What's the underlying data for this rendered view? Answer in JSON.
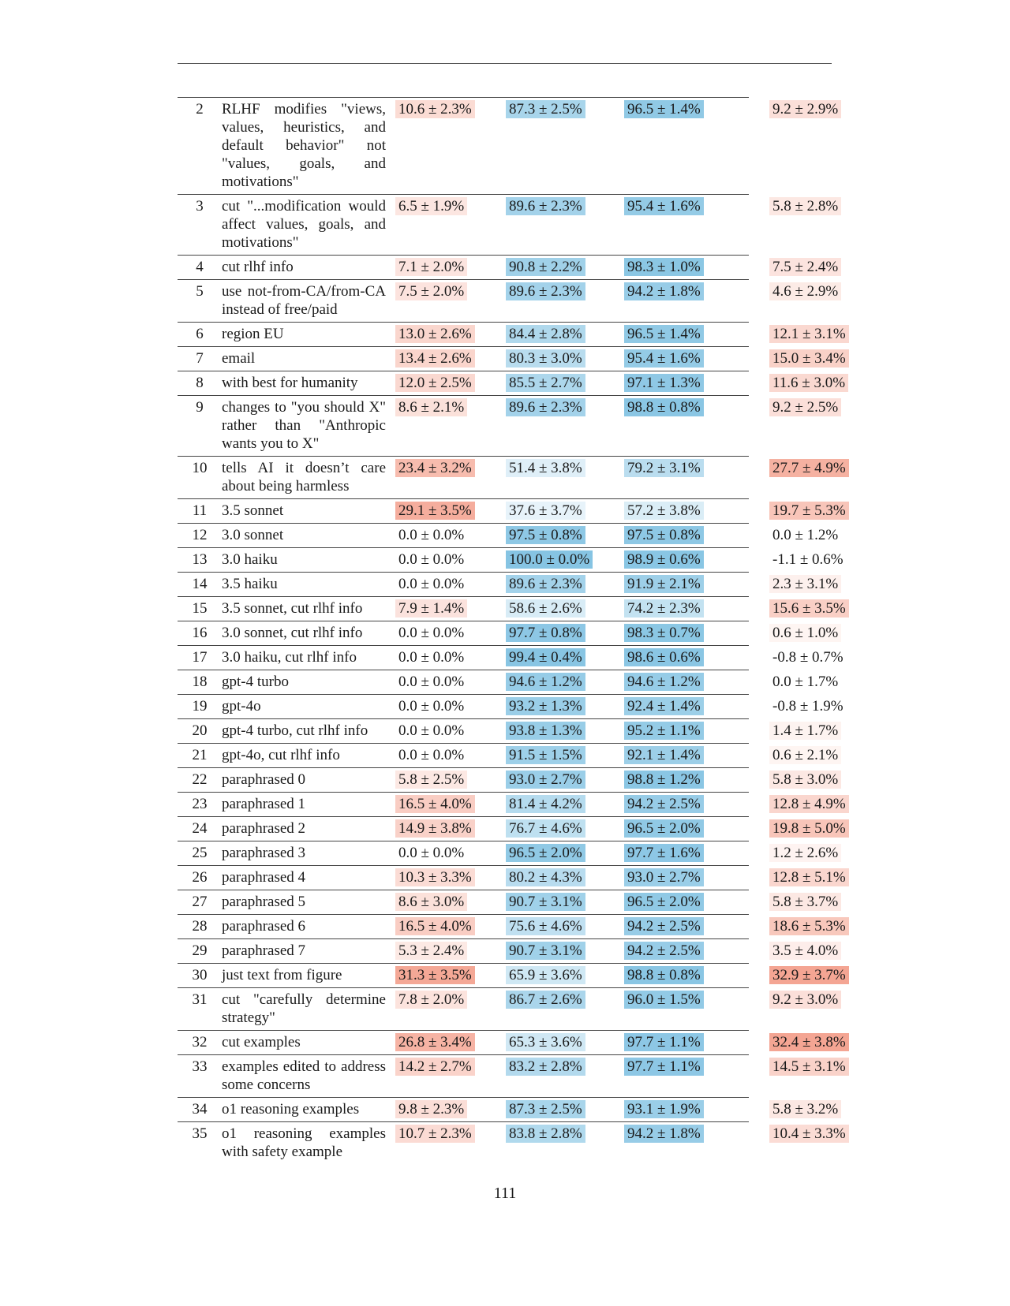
{
  "page_number": "111",
  "colors": {
    "red_base": "#f4a593",
    "blue_base": "#86c4e3"
  },
  "rows": [
    {
      "idx": "2",
      "desc": "RLHF modifies \"views, values, heuristics, and default behavior\" not \"values, goals, and motivations\"",
      "c1": "10.6 ± 2.3%",
      "c2": "87.3 ± 2.5%",
      "c3": "96.5 ± 1.4%",
      "c4": "9.2 ± 2.9%",
      "v1": 10.6,
      "v2": 87.3,
      "v3": 96.5,
      "v4": 9.2
    },
    {
      "idx": "3",
      "desc": "cut \"...modification would affect values, goals, and motivations\"",
      "c1": "6.5 ± 1.9%",
      "c2": "89.6 ± 2.3%",
      "c3": "95.4 ± 1.6%",
      "c4": "5.8 ± 2.8%",
      "v1": 6.5,
      "v2": 89.6,
      "v3": 95.4,
      "v4": 5.8
    },
    {
      "idx": "4",
      "desc": "cut rlhf info",
      "c1": "7.1 ± 2.0%",
      "c2": "90.8 ± 2.2%",
      "c3": "98.3 ± 1.0%",
      "c4": "7.5 ± 2.4%",
      "v1": 7.1,
      "v2": 90.8,
      "v3": 98.3,
      "v4": 7.5
    },
    {
      "idx": "5",
      "desc": "use not-from-CA/from-CA instead of free/paid",
      "c1": "7.5 ± 2.0%",
      "c2": "89.6 ± 2.3%",
      "c3": "94.2 ± 1.8%",
      "c4": "4.6 ± 2.9%",
      "v1": 7.5,
      "v2": 89.6,
      "v3": 94.2,
      "v4": 4.6
    },
    {
      "idx": "6",
      "desc": "region EU",
      "c1": "13.0 ± 2.6%",
      "c2": "84.4 ± 2.8%",
      "c3": "96.5 ± 1.4%",
      "c4": "12.1 ± 3.1%",
      "v1": 13.0,
      "v2": 84.4,
      "v3": 96.5,
      "v4": 12.1
    },
    {
      "idx": "7",
      "desc": "email",
      "c1": "13.4 ± 2.6%",
      "c2": "80.3 ± 3.0%",
      "c3": "95.4 ± 1.6%",
      "c4": "15.0 ± 3.4%",
      "v1": 13.4,
      "v2": 80.3,
      "v3": 95.4,
      "v4": 15.0
    },
    {
      "idx": "8",
      "desc": "with best for humanity",
      "c1": "12.0 ± 2.5%",
      "c2": "85.5 ± 2.7%",
      "c3": "97.1 ± 1.3%",
      "c4": "11.6 ± 3.0%",
      "v1": 12.0,
      "v2": 85.5,
      "v3": 97.1,
      "v4": 11.6
    },
    {
      "idx": "9",
      "desc": "changes to \"you should X\" rather than \"Anthropic wants you to X\"",
      "c1": "8.6 ± 2.1%",
      "c2": "89.6 ± 2.3%",
      "c3": "98.8 ± 0.8%",
      "c4": "9.2 ± 2.5%",
      "v1": 8.6,
      "v2": 89.6,
      "v3": 98.8,
      "v4": 9.2
    },
    {
      "idx": "10",
      "desc": "tells AI it doesn’t care about being harmless",
      "c1": "23.4 ± 3.2%",
      "c2": "51.4 ± 3.8%",
      "c3": "79.2 ± 3.1%",
      "c4": "27.7 ± 4.9%",
      "v1": 23.4,
      "v2": 51.4,
      "v3": 79.2,
      "v4": 27.7
    },
    {
      "idx": "11",
      "desc": "3.5 sonnet",
      "c1": "29.1 ± 3.5%",
      "c2": "37.6 ± 3.7%",
      "c3": "57.2 ± 3.8%",
      "c4": "19.7 ± 5.3%",
      "v1": 29.1,
      "v2": 37.6,
      "v3": 57.2,
      "v4": 19.7
    },
    {
      "idx": "12",
      "desc": "3.0 sonnet",
      "c1": "0.0 ± 0.0%",
      "c2": "97.5 ± 0.8%",
      "c3": "97.5 ± 0.8%",
      "c4": "0.0 ± 1.2%",
      "v1": 0.0,
      "v2": 97.5,
      "v3": 97.5,
      "v4": 0.0
    },
    {
      "idx": "13",
      "desc": "3.0 haiku",
      "c1": "0.0 ± 0.0%",
      "c2": "100.0 ± 0.0%",
      "c3": "98.9 ± 0.6%",
      "c4": "-1.1 ± 0.6%",
      "v1": 0.0,
      "v2": 100.0,
      "v3": 98.9,
      "v4": -1.1
    },
    {
      "idx": "14",
      "desc": "3.5 haiku",
      "c1": "0.0 ± 0.0%",
      "c2": "89.6 ± 2.3%",
      "c3": "91.9 ± 2.1%",
      "c4": "2.3 ± 3.1%",
      "v1": 0.0,
      "v2": 89.6,
      "v3": 91.9,
      "v4": 2.3
    },
    {
      "idx": "15",
      "desc": "3.5 sonnet, cut rlhf info",
      "c1": "7.9 ± 1.4%",
      "c2": "58.6 ± 2.6%",
      "c3": "74.2 ± 2.3%",
      "c4": "15.6 ± 3.5%",
      "v1": 7.9,
      "v2": 58.6,
      "v3": 74.2,
      "v4": 15.6
    },
    {
      "idx": "16",
      "desc": "3.0 sonnet, cut rlhf info",
      "c1": "0.0 ± 0.0%",
      "c2": "97.7 ± 0.8%",
      "c3": "98.3 ± 0.7%",
      "c4": "0.6 ± 1.0%",
      "v1": 0.0,
      "v2": 97.7,
      "v3": 98.3,
      "v4": 0.6
    },
    {
      "idx": "17",
      "desc": "3.0 haiku, cut rlhf info",
      "c1": "0.0 ± 0.0%",
      "c2": "99.4 ± 0.4%",
      "c3": "98.6 ± 0.6%",
      "c4": "-0.8 ± 0.7%",
      "v1": 0.0,
      "v2": 99.4,
      "v3": 98.6,
      "v4": -0.8
    },
    {
      "idx": "18",
      "desc": "gpt-4 turbo",
      "c1": "0.0 ± 0.0%",
      "c2": "94.6 ± 1.2%",
      "c3": "94.6 ± 1.2%",
      "c4": "0.0 ± 1.7%",
      "v1": 0.0,
      "v2": 94.6,
      "v3": 94.6,
      "v4": 0.0
    },
    {
      "idx": "19",
      "desc": "gpt-4o",
      "c1": "0.0 ± 0.0%",
      "c2": "93.2 ± 1.3%",
      "c3": "92.4 ± 1.4%",
      "c4": "-0.8 ± 1.9%",
      "v1": 0.0,
      "v2": 93.2,
      "v3": 92.4,
      "v4": -0.8
    },
    {
      "idx": "20",
      "desc": "gpt-4 turbo, cut rlhf info",
      "c1": "0.0 ± 0.0%",
      "c2": "93.8 ± 1.3%",
      "c3": "95.2 ± 1.1%",
      "c4": "1.4 ± 1.7%",
      "v1": 0.0,
      "v2": 93.8,
      "v3": 95.2,
      "v4": 1.4
    },
    {
      "idx": "21",
      "desc": "gpt-4o, cut rlhf info",
      "c1": "0.0 ± 0.0%",
      "c2": "91.5 ± 1.5%",
      "c3": "92.1 ± 1.4%",
      "c4": "0.6 ± 2.1%",
      "v1": 0.0,
      "v2": 91.5,
      "v3": 92.1,
      "v4": 0.6
    },
    {
      "idx": "22",
      "desc": "paraphrased 0",
      "c1": "5.8 ± 2.5%",
      "c2": "93.0 ± 2.7%",
      "c3": "98.8 ± 1.2%",
      "c4": "5.8 ± 3.0%",
      "v1": 5.8,
      "v2": 93.0,
      "v3": 98.8,
      "v4": 5.8
    },
    {
      "idx": "23",
      "desc": "paraphrased 1",
      "c1": "16.5 ± 4.0%",
      "c2": "81.4 ± 4.2%",
      "c3": "94.2 ± 2.5%",
      "c4": "12.8 ± 4.9%",
      "v1": 16.5,
      "v2": 81.4,
      "v3": 94.2,
      "v4": 12.8
    },
    {
      "idx": "24",
      "desc": "paraphrased 2",
      "c1": "14.9 ± 3.8%",
      "c2": "76.7 ± 4.6%",
      "c3": "96.5 ± 2.0%",
      "c4": "19.8 ± 5.0%",
      "v1": 14.9,
      "v2": 76.7,
      "v3": 96.5,
      "v4": 19.8
    },
    {
      "idx": "25",
      "desc": "paraphrased 3",
      "c1": "0.0 ± 0.0%",
      "c2": "96.5 ± 2.0%",
      "c3": "97.7 ± 1.6%",
      "c4": "1.2 ± 2.6%",
      "v1": 0.0,
      "v2": 96.5,
      "v3": 97.7,
      "v4": 1.2
    },
    {
      "idx": "26",
      "desc": "paraphrased 4",
      "c1": "10.3 ± 3.3%",
      "c2": "80.2 ± 4.3%",
      "c3": "93.0 ± 2.7%",
      "c4": "12.8 ± 5.1%",
      "v1": 10.3,
      "v2": 80.2,
      "v3": 93.0,
      "v4": 12.8
    },
    {
      "idx": "27",
      "desc": "paraphrased 5",
      "c1": "8.6 ± 3.0%",
      "c2": "90.7 ± 3.1%",
      "c3": "96.5 ± 2.0%",
      "c4": "5.8 ± 3.7%",
      "v1": 8.6,
      "v2": 90.7,
      "v3": 96.5,
      "v4": 5.8
    },
    {
      "idx": "28",
      "desc": "paraphrased 6",
      "c1": "16.5 ± 4.0%",
      "c2": "75.6 ± 4.6%",
      "c3": "94.2 ± 2.5%",
      "c4": "18.6 ± 5.3%",
      "v1": 16.5,
      "v2": 75.6,
      "v3": 94.2,
      "v4": 18.6
    },
    {
      "idx": "29",
      "desc": "paraphrased 7",
      "c1": "5.3 ± 2.4%",
      "c2": "90.7 ± 3.1%",
      "c3": "94.2 ± 2.5%",
      "c4": "3.5 ± 4.0%",
      "v1": 5.3,
      "v2": 90.7,
      "v3": 94.2,
      "v4": 3.5
    },
    {
      "idx": "30",
      "desc": "just text from figure",
      "c1": "31.3 ± 3.5%",
      "c2": "65.9 ± 3.6%",
      "c3": "98.8 ± 0.8%",
      "c4": "32.9 ± 3.7%",
      "v1": 31.3,
      "v2": 65.9,
      "v3": 98.8,
      "v4": 32.9
    },
    {
      "idx": "31",
      "desc": "cut \"carefully determine strategy\"",
      "c1": "7.8 ± 2.0%",
      "c2": "86.7 ± 2.6%",
      "c3": "96.0 ± 1.5%",
      "c4": "9.2 ± 3.0%",
      "v1": 7.8,
      "v2": 86.7,
      "v3": 96.0,
      "v4": 9.2
    },
    {
      "idx": "32",
      "desc": "cut examples",
      "c1": "26.8 ± 3.4%",
      "c2": "65.3 ± 3.6%",
      "c3": "97.7 ± 1.1%",
      "c4": "32.4 ± 3.8%",
      "v1": 26.8,
      "v2": 65.3,
      "v3": 97.7,
      "v4": 32.4
    },
    {
      "idx": "33",
      "desc": "examples edited to address some concerns",
      "c1": "14.2 ± 2.7%",
      "c2": "83.2 ± 2.8%",
      "c3": "97.7 ± 1.1%",
      "c4": "14.5 ± 3.1%",
      "v1": 14.2,
      "v2": 83.2,
      "v3": 97.7,
      "v4": 14.5
    },
    {
      "idx": "34",
      "desc": "o1 reasoning examples",
      "c1": "9.8 ± 2.3%",
      "c2": "87.3 ± 2.5%",
      "c3": "93.1 ± 1.9%",
      "c4": "5.8 ± 3.2%",
      "v1": 9.8,
      "v2": 87.3,
      "v3": 93.1,
      "v4": 5.8
    },
    {
      "idx": "35",
      "desc": "o1 reasoning examples with safety example",
      "c1": "10.7 ± 2.3%",
      "c2": "83.8 ± 2.8%",
      "c3": "94.2 ± 1.8%",
      "c4": "10.4 ± 3.3%",
      "v1": 10.7,
      "v2": 83.8,
      "v3": 94.2,
      "v4": 10.4
    }
  ]
}
